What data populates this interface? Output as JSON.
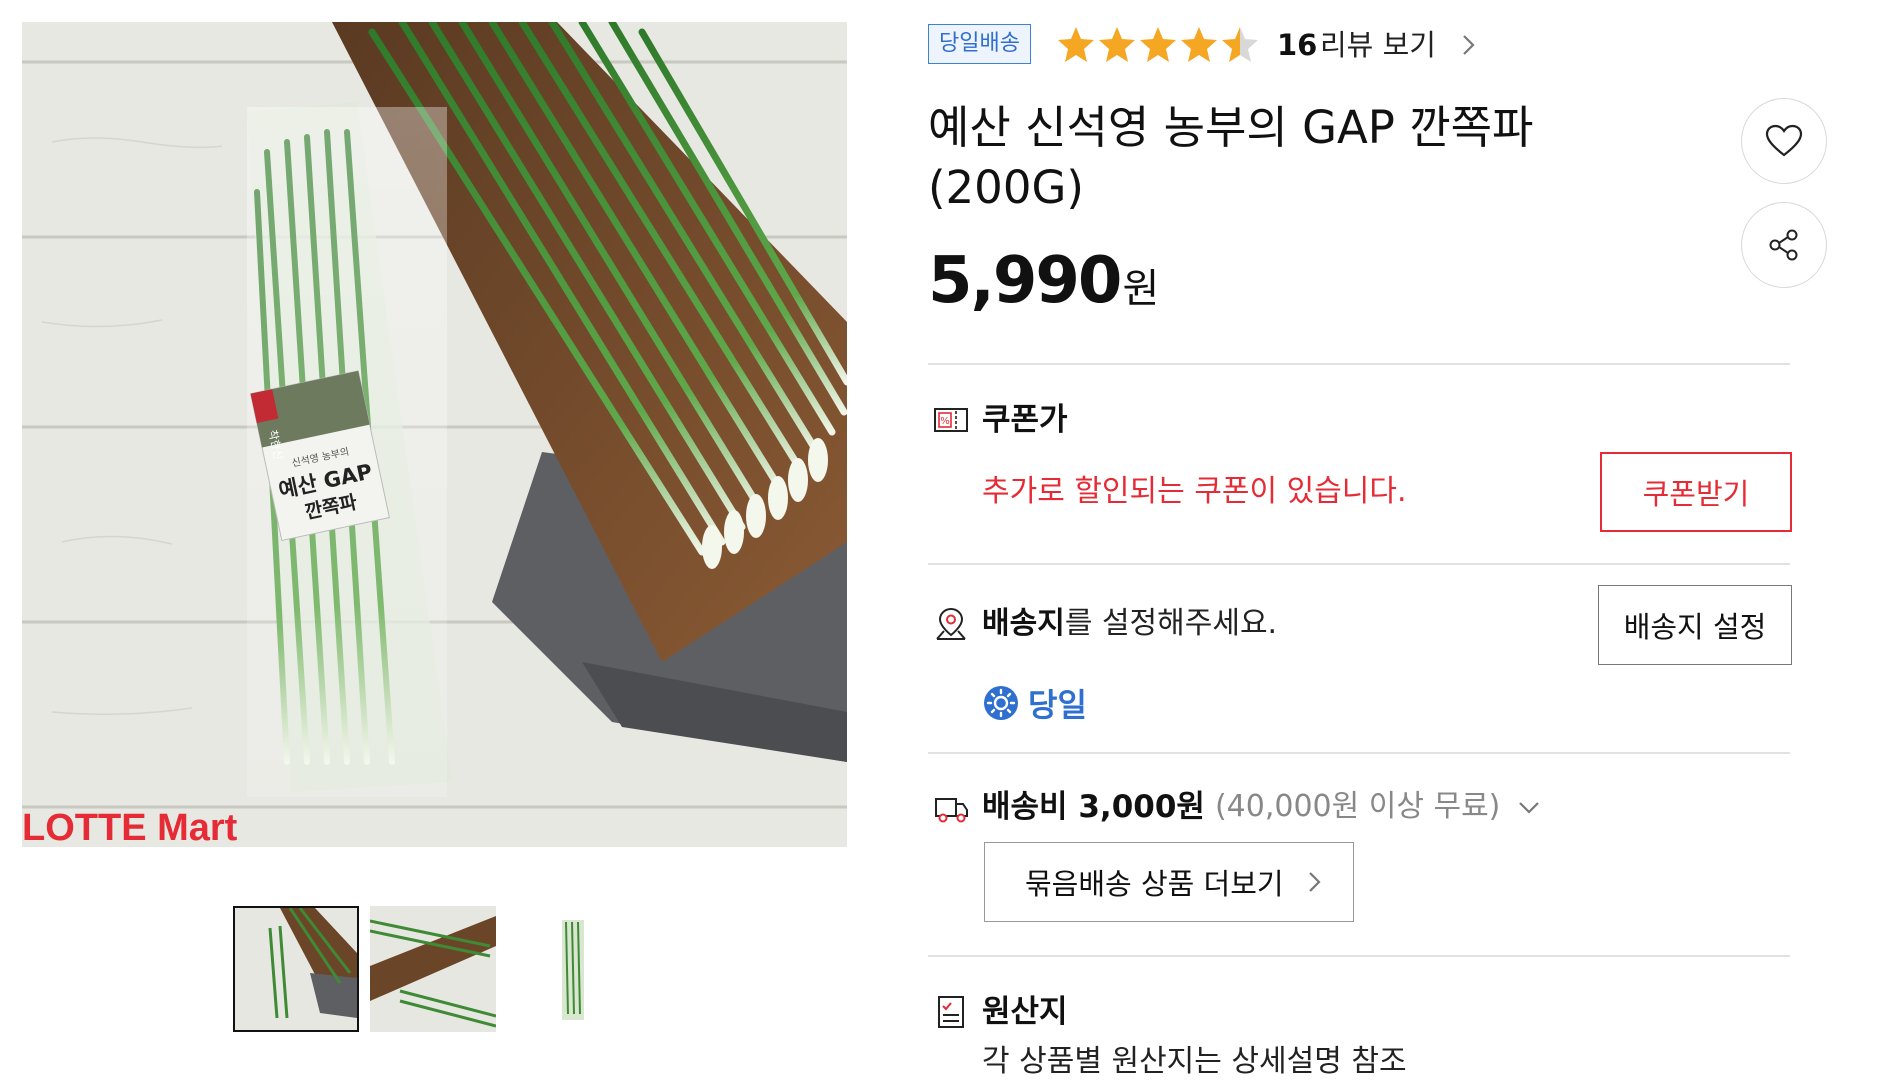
{
  "image": {
    "brand_watermark": "LOTTE Mart",
    "package_label_line1": "예산 GAP",
    "package_label_line2": "깐쪽파",
    "package_brand": "신석영 농부의",
    "package_sticker": "착한신"
  },
  "thumbnails": [
    {
      "name": "thumbnail-1",
      "active": true
    },
    {
      "name": "thumbnail-2",
      "active": false
    },
    {
      "name": "thumbnail-3",
      "active": false
    }
  ],
  "badge": "당일배송",
  "rating": {
    "value": 4.5,
    "max": 5,
    "count": "16",
    "link": "리뷰 보기"
  },
  "title": "예산 신석영 농부의 GAP 깐쪽파 (200G)",
  "price": {
    "amount": "5,990",
    "currency": "원"
  },
  "coupon": {
    "label": "쿠폰가",
    "message": "추가로 할인되는 쿠폰이 있습니다.",
    "button": "쿠폰받기"
  },
  "address": {
    "label_bold": "배송지",
    "label_rest": "를 설정해주세요.",
    "button": "배송지 설정"
  },
  "sameday": {
    "label": "당일"
  },
  "shipping": {
    "label": "배송비 3,000원",
    "note": "(40,000원 이상 무료)",
    "bundle_button": "묶음배송 상품 더보기"
  },
  "origin": {
    "label": "원산지",
    "text": "각 상품별 원산지는 상세설명 참조"
  },
  "colors": {
    "accent_red": "#e52c36",
    "accent_blue": "#2f6fd0",
    "star": "#f5a623"
  }
}
